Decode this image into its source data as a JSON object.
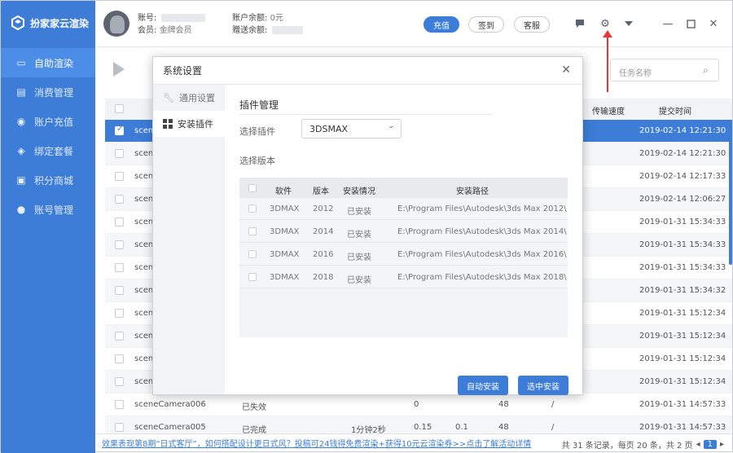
{
  "app": {
    "name": "扮家家云渲染"
  },
  "sidebar": {
    "items": [
      {
        "label": "自助渲染",
        "icon": "monitor-icon",
        "active": true
      },
      {
        "label": "消费管理",
        "icon": "ledger-icon"
      },
      {
        "label": "账户充值",
        "icon": "coin-icon"
      },
      {
        "label": "绑定套餐",
        "icon": "package-icon"
      },
      {
        "label": "积分商城",
        "icon": "gift-icon"
      },
      {
        "label": "账号管理",
        "icon": "user-icon"
      }
    ]
  },
  "topbar": {
    "account_label": "账号:",
    "member_label": "会员:",
    "member_value": "金牌会员",
    "balance_label": "账户余额:",
    "balance_value": "0元",
    "gift_label": "赠送余额:",
    "recharge_button": "充值",
    "checkin_button": "签到",
    "service_button": "客服"
  },
  "toolbar": {
    "search_placeholder": "任务名称"
  },
  "table": {
    "headers": {
      "speed": "传输速度",
      "submit_time": "提交时间"
    },
    "rows": [
      {
        "name": "scene",
        "time": "2019-02-14 12:21:30",
        "selected": true
      },
      {
        "name": "scene",
        "time": "2019-02-14 12:21:30"
      },
      {
        "name": "scene",
        "time": "2019-02-14 12:17:33"
      },
      {
        "name": "scene",
        "time": "2019-02-14 12:06:27"
      },
      {
        "name": "scene",
        "time": "2019-01-31 15:34:33"
      },
      {
        "name": "scene",
        "time": "2019-01-31 15:34:33"
      },
      {
        "name": "scene",
        "time": "2019-01-31 15:34:33"
      },
      {
        "name": "scene",
        "time": "2019-01-31 15:34:32"
      },
      {
        "name": "scene",
        "time": "2019-01-31 15:12:34"
      },
      {
        "name": "scene",
        "time": "2019-01-31 15:12:34"
      },
      {
        "name": "scene",
        "time": "2019-01-31 15:12:34"
      },
      {
        "name": "scene",
        "time": "2019-01-31 15:12:34"
      },
      {
        "name": "sceneCamera006",
        "status": "已失效",
        "duration": "",
        "c1": "0",
        "c2": "",
        "c3": "48",
        "speed": "/",
        "time": "2019-01-31 14:57:33"
      },
      {
        "name": "sceneCamera005",
        "status": "已完成",
        "duration": "1分钟2秒",
        "c1": "0.15",
        "c2": "0.1",
        "c3": "48",
        "speed": "/",
        "time": "2019-01-31 14:57:33"
      }
    ]
  },
  "footer": {
    "promo": "效果表现第8期“日式客厅”，如何搭配设计更日式风？投稿可24钱得免费渲染+获得10元云渲染券>>点击了解活动详情",
    "pager_text": "共 31 条记录，每页 20 条，共 2 页",
    "current_page": "1"
  },
  "dialog": {
    "title": "系统设置",
    "tabs": [
      {
        "label": "通用设置",
        "icon": "wrench-icon"
      },
      {
        "label": "安装插件",
        "icon": "plugin-grid-icon",
        "active": true
      }
    ],
    "section_title": "插件管理",
    "select_plugin_label": "选择插件",
    "plugin_value": "3DSMAX",
    "select_version_label": "选择版本",
    "table": {
      "headers": {
        "software": "软件",
        "version": "版本",
        "status": "安装情况",
        "path": "安装路径"
      },
      "rows": [
        {
          "software": "3DMAX",
          "version": "2012",
          "status": "已安装",
          "path": "E:\\Program Files\\Autodesk\\3ds Max 2012\\"
        },
        {
          "software": "3DMAX",
          "version": "2014",
          "status": "已安装",
          "path": "E:\\Program Files\\Autodesk\\3ds Max 2014\\"
        },
        {
          "software": "3DMAX",
          "version": "2016",
          "status": "已安装",
          "path": "E:\\Program Files\\Autodesk\\3ds Max 2016\\"
        },
        {
          "software": "3DMAX",
          "version": "2018",
          "status": "已安装",
          "path": "E:\\Program Files\\Autodesk\\3ds Max 2018\\"
        }
      ]
    },
    "auto_install_button": "自动安装",
    "install_selected_button": "选中安装"
  },
  "colors": {
    "primary": "#3d7dd8",
    "annotation_arrow": "#e53935"
  }
}
